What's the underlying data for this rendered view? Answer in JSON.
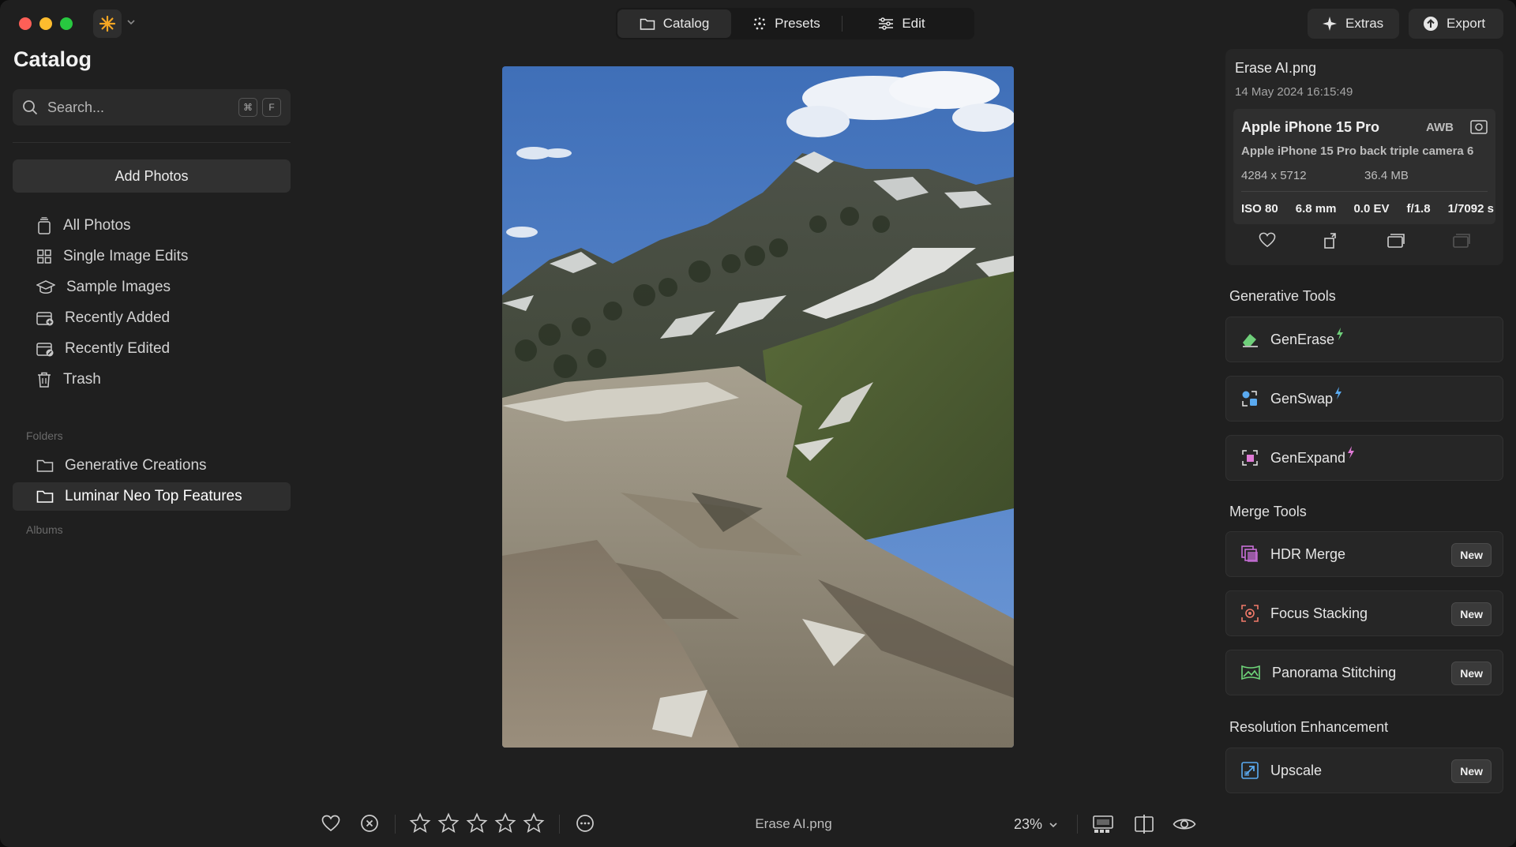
{
  "titlebar": {
    "segments": [
      {
        "label": "Catalog",
        "icon": "folder-icon"
      },
      {
        "label": "Presets",
        "icon": "sparkle-icon"
      },
      {
        "label": "Edit",
        "icon": "sliders-icon"
      }
    ],
    "extras_label": "Extras",
    "export_label": "Export"
  },
  "sidebar": {
    "title": "Catalog",
    "search_placeholder": "Search...",
    "shortcut_keys": [
      "⌘",
      "F"
    ],
    "add_photos_label": "Add Photos",
    "items": [
      {
        "label": "All Photos",
        "icon": "photos-icon"
      },
      {
        "label": "Single Image Edits",
        "icon": "grid-icon"
      },
      {
        "label": "Sample Images",
        "icon": "graduation-cap-icon"
      },
      {
        "label": "Recently Added",
        "icon": "calendar-add-icon"
      },
      {
        "label": "Recently Edited",
        "icon": "calendar-edit-icon"
      },
      {
        "label": "Trash",
        "icon": "trash-icon"
      }
    ],
    "folders_heading": "Folders",
    "folders": [
      {
        "label": "Generative Creations",
        "active": false
      },
      {
        "label": "Luminar Neo Top Features",
        "active": true
      }
    ],
    "albums_heading": "Albums"
  },
  "viewer": {
    "filename": "Erase AI.png",
    "zoom": "23%",
    "rating_stars": 5
  },
  "info": {
    "filename": "Erase AI.png",
    "date": "14 May 2024 16:15:49",
    "camera_model": "Apple iPhone 15 Pro",
    "white_balance": "AWB",
    "lens": "Apple iPhone 15 Pro back triple camera 6",
    "dimensions": "4284 x 5712",
    "file_size": "36.4 MB",
    "exif": [
      "ISO 80",
      "6.8 mm",
      "0.0 EV",
      "f/1.8",
      "1/7092 s"
    ]
  },
  "tools": {
    "generative_heading": "Generative Tools",
    "generative": [
      {
        "label": "GenErase",
        "color": "#6fcf7a"
      },
      {
        "label": "GenSwap",
        "color": "#5aaaf0"
      },
      {
        "label": "GenExpand",
        "color": "#e07ad6"
      }
    ],
    "merge_heading": "Merge Tools",
    "merge": [
      {
        "label": "HDR Merge",
        "badge": "New",
        "color": "#c86fd8"
      },
      {
        "label": "Focus Stacking",
        "badge": "New",
        "color": "#f07a6a"
      },
      {
        "label": "Panorama Stitching",
        "badge": "New",
        "color": "#6fd67a"
      }
    ],
    "resolution_heading": "Resolution Enhancement",
    "resolution": [
      {
        "label": "Upscale",
        "badge": "New",
        "color": "#5aaaf0"
      }
    ]
  }
}
